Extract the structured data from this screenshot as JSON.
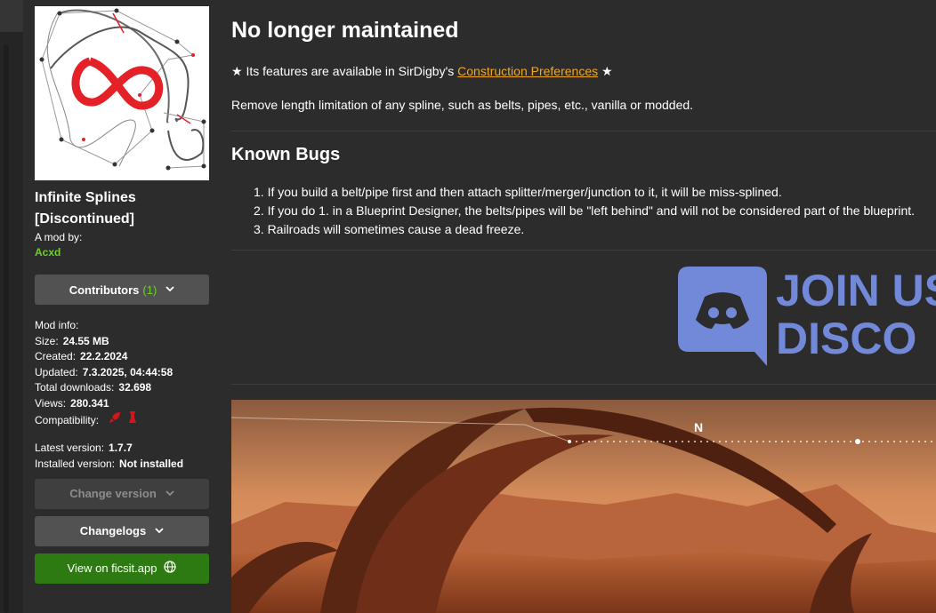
{
  "sidebar": {
    "title_line1": "Infinite Splines",
    "title_line2": "[Discontinued]",
    "author_label": "A mod by:",
    "author": "Acxd",
    "contributors_label": "Contributors",
    "contributors_count": "(1)",
    "mod_info_label": "Mod info:",
    "size_label": "Size:",
    "size_value": "24.55 MB",
    "created_label": "Created:",
    "created_value": "22.2.2024",
    "updated_label": "Updated:",
    "updated_value": "7.3.2025, 04:44:58",
    "downloads_label": "Total downloads:",
    "downloads_value": "32.698",
    "views_label": "Views:",
    "views_value": "280.341",
    "compat_label": "Compatibility:",
    "latest_label": "Latest version:",
    "latest_value": "1.7.7",
    "installed_label": "Installed version:",
    "installed_value": "Not installed",
    "change_version_label": "Change version",
    "changelogs_label": "Changelogs",
    "ficsit_label": "View on ficsit.app"
  },
  "main": {
    "title": "No longer maintained",
    "star": "★",
    "feature_prefix": "Its features are available in SirDigby's",
    "feature_link": "Construction Preferences",
    "description": "Remove length limitation of any spline, such as belts, pipes, etc., vanilla or modded.",
    "bugs_title": "Known Bugs",
    "bugs": [
      "1. If you build a belt/pipe first and then attach splitter/merger/junction to it, it will be miss-splined.",
      "2. If you do 1. in a Blueprint Designer, the belts/pipes will be \"left behind\" and will not be considered part of the blueprint.",
      "3. Railroads will sometimes cause a dead freeze."
    ],
    "discord_line1": "JOIN US",
    "discord_line2": "DISCO",
    "compass_letter": "N"
  },
  "colors": {
    "accent_green": "#6fce2c",
    "link_orange": "#f0a81e",
    "discord_blue": "#7289da",
    "ficsit_green": "#2e7a12"
  },
  "icons": {
    "chevron": "chevron-down-icon",
    "globe": "globe-icon",
    "compat_ea": "rocket-icon",
    "compat_exp": "flask-icon"
  }
}
